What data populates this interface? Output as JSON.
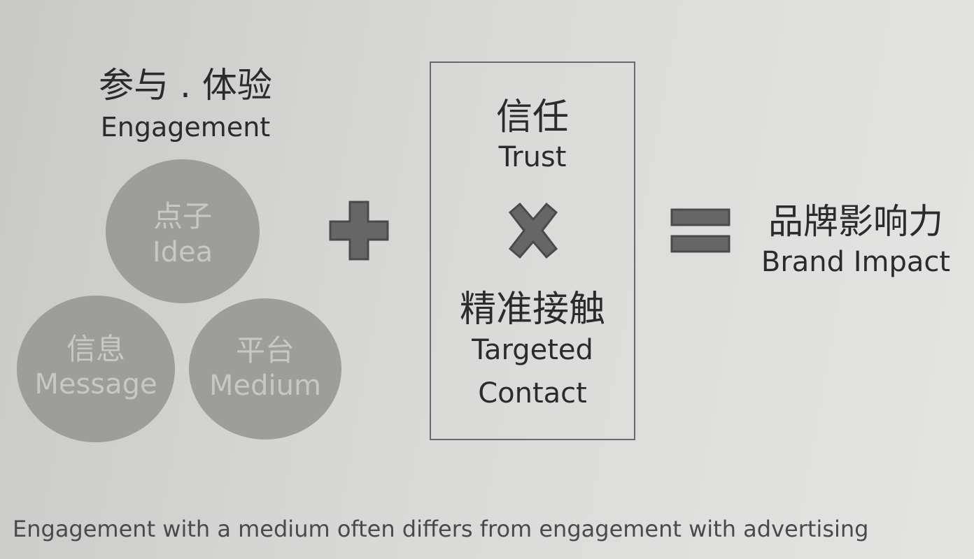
{
  "engagement": {
    "title_cn": "参与 . 体验",
    "title_en": "Engagement",
    "circles": {
      "idea": {
        "cn": "点子",
        "en": "Idea"
      },
      "message": {
        "cn": "信息",
        "en": "Message"
      },
      "medium": {
        "cn": "平台",
        "en": "Medium"
      }
    }
  },
  "operators": {
    "plus_icon": "plus-icon",
    "times_icon": "times-icon",
    "equals_icon": "equals-icon"
  },
  "box": {
    "trust_cn": "信任",
    "trust_en": "Trust",
    "targeted_cn": "精准接触",
    "targeted_en_line1": "Targeted",
    "targeted_en_line2": "Contact"
  },
  "result": {
    "cn": "品牌影响力",
    "en": "Brand Impact"
  },
  "caption": "Engagement with a medium often differs from engagement with advertising",
  "colors": {
    "circle_fill": "#9d9d9b",
    "circle_text": "#c7c7c5",
    "operator": "#666666",
    "text": "#2b2b2b"
  }
}
